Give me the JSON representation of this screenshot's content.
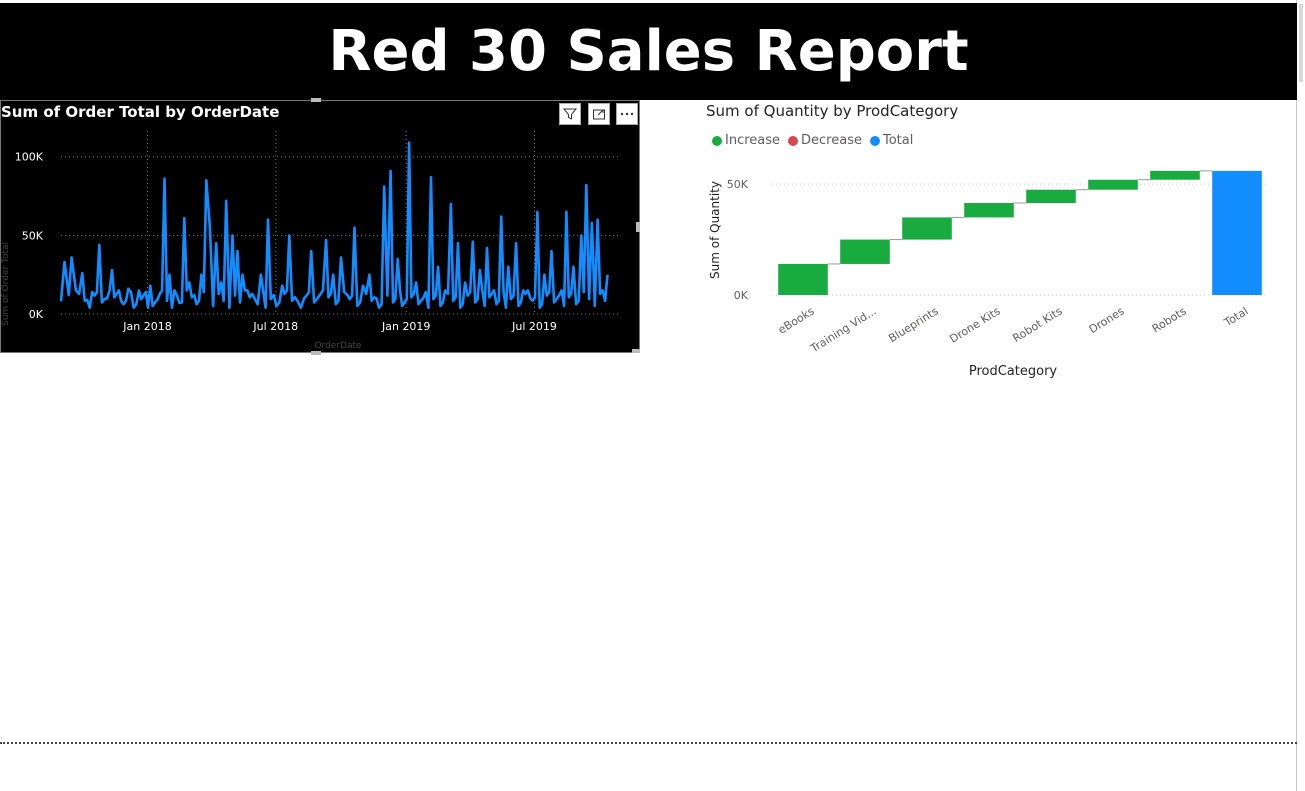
{
  "report": {
    "title": "Red 30 Sales Report"
  },
  "line_visual": {
    "title": "Sum of Order Total by OrderDate",
    "header_icons": [
      "filter-icon",
      "focus-mode-icon",
      "more-options-icon"
    ]
  },
  "waterfall_visual": {
    "title": "Sum of Quantity by ProdCategory",
    "legend_label": "",
    "legend": [
      {
        "label": "Increase",
        "color": "#1AAB40"
      },
      {
        "label": "Decrease",
        "color": "#D64550"
      },
      {
        "label": "Total",
        "color": "#118DFF"
      }
    ]
  },
  "chart_data": [
    {
      "type": "line",
      "title": "Sum of Order Total by OrderDate",
      "xlabel": "OrderDate",
      "ylabel": "Sum of Order Total",
      "ylim": [
        0,
        110000
      ],
      "y_ticks": [
        "0K",
        "50K",
        "100K"
      ],
      "x_ticks": [
        "Jan 2018",
        "Jul 2018",
        "Jan 2019",
        "Jul 2019"
      ],
      "x_range": [
        "2017-09-01",
        "2019-10-31"
      ],
      "grid": true,
      "series": [
        {
          "color": "#118DFF",
          "points": [
            [
              "2017-09-01",
              8000
            ],
            [
              "2017-09-06",
              33000
            ],
            [
              "2017-09-12",
              12000
            ],
            [
              "2017-09-16",
              36000
            ],
            [
              "2017-09-22",
              15000
            ],
            [
              "2017-10-01",
              26000
            ],
            [
              "2017-10-08",
              9000
            ],
            [
              "2017-10-15",
              14000
            ],
            [
              "2017-10-25",
              44000
            ],
            [
              "2017-11-05",
              10000
            ],
            [
              "2017-11-12",
              28000
            ],
            [
              "2017-11-25",
              8000
            ],
            [
              "2017-12-05",
              16000
            ],
            [
              "2017-12-20",
              15000
            ],
            [
              "2018-01-05",
              18000
            ],
            [
              "2018-01-15",
              9000
            ],
            [
              "2018-01-25",
              86000
            ],
            [
              "2018-02-01",
              25000
            ],
            [
              "2018-02-08",
              15000
            ],
            [
              "2018-02-15",
              7000
            ],
            [
              "2018-02-22",
              61000
            ],
            [
              "2018-03-01",
              20000
            ],
            [
              "2018-03-08",
              12000
            ],
            [
              "2018-03-18",
              25000
            ],
            [
              "2018-03-25",
              85000
            ],
            [
              "2018-03-30",
              55000
            ],
            [
              "2018-04-08",
              45000
            ],
            [
              "2018-04-15",
              20000
            ],
            [
              "2018-04-22",
              72000
            ],
            [
              "2018-05-01",
              50000
            ],
            [
              "2018-05-08",
              40000
            ],
            [
              "2018-05-15",
              25000
            ],
            [
              "2018-05-22",
              15000
            ],
            [
              "2018-06-01",
              10000
            ],
            [
              "2018-06-10",
              25000
            ],
            [
              "2018-06-20",
              60000
            ],
            [
              "2018-06-28",
              12000
            ],
            [
              "2018-07-10",
              18000
            ],
            [
              "2018-07-20",
              50000
            ],
            [
              "2018-08-01",
              8000
            ],
            [
              "2018-08-10",
              10000
            ],
            [
              "2018-08-20",
              40000
            ],
            [
              "2018-09-01",
              12000
            ],
            [
              "2018-09-10",
              47000
            ],
            [
              "2018-09-20",
              25000
            ],
            [
              "2018-10-01",
              36000
            ],
            [
              "2018-10-10",
              12000
            ],
            [
              "2018-10-20",
              55000
            ],
            [
              "2018-11-01",
              18000
            ],
            [
              "2018-11-10",
              25000
            ],
            [
              "2018-11-20",
              10000
            ],
            [
              "2018-12-01",
              81000
            ],
            [
              "2018-12-10",
              91000
            ],
            [
              "2018-12-20",
              35000
            ],
            [
              "2019-01-05",
              109000
            ],
            [
              "2019-01-15",
              20000
            ],
            [
              "2019-01-25",
              10000
            ],
            [
              "2019-02-05",
              87000
            ],
            [
              "2019-02-15",
              30000
            ],
            [
              "2019-02-25",
              15000
            ],
            [
              "2019-03-05",
              70000
            ],
            [
              "2019-03-15",
              45000
            ],
            [
              "2019-03-25",
              20000
            ],
            [
              "2019-04-05",
              46000
            ],
            [
              "2019-04-15",
              28000
            ],
            [
              "2019-04-25",
              42000
            ],
            [
              "2019-05-05",
              15000
            ],
            [
              "2019-05-15",
              62000
            ],
            [
              "2019-05-25",
              30000
            ],
            [
              "2019-06-05",
              45000
            ],
            [
              "2019-06-15",
              15000
            ],
            [
              "2019-06-25",
              10000
            ],
            [
              "2019-07-05",
              65000
            ],
            [
              "2019-07-15",
              25000
            ],
            [
              "2019-07-25",
              40000
            ],
            [
              "2019-08-05",
              12000
            ],
            [
              "2019-08-15",
              65000
            ],
            [
              "2019-08-25",
              30000
            ],
            [
              "2019-09-05",
              50000
            ],
            [
              "2019-09-12",
              82000
            ],
            [
              "2019-09-20",
              58000
            ],
            [
              "2019-09-28",
              60000
            ],
            [
              "2019-10-05",
              15000
            ],
            [
              "2019-10-12",
              25000
            ]
          ]
        }
      ]
    },
    {
      "type": "bar",
      "subtype": "waterfall",
      "title": "Sum of Quantity by ProdCategory",
      "xlabel": "ProdCategory",
      "ylabel": "Sum of Quantity",
      "ylim": [
        0,
        60000
      ],
      "y_ticks": [
        "0K",
        "50K"
      ],
      "grid": true,
      "legend_position": "top-left",
      "categories": [
        "eBooks",
        "Training Vid...",
        "Blueprints",
        "Drone Kits",
        "Robot Kits",
        "Drones",
        "Robots",
        "Total"
      ],
      "series": [
        {
          "name": "Increase",
          "values": [
            14000,
            11000,
            10000,
            6500,
            6000,
            4500,
            4000,
            null
          ]
        },
        {
          "name": "Total",
          "values": [
            null,
            null,
            null,
            null,
            null,
            null,
            null,
            56000
          ]
        }
      ]
    }
  ]
}
